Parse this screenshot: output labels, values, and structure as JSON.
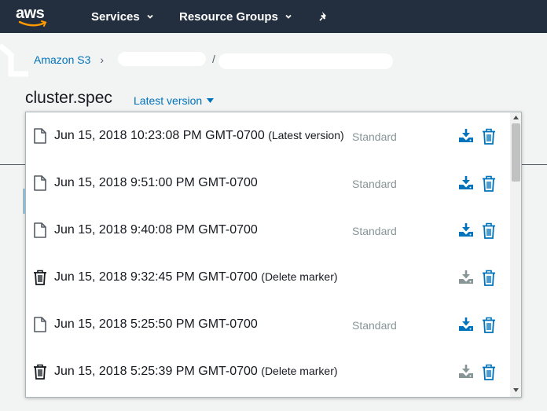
{
  "topnav": {
    "logo_text": "aws",
    "services_label": "Services",
    "resource_groups_label": "Resource Groups"
  },
  "breadcrumb": {
    "root": "Amazon S3",
    "separator": "/"
  },
  "page": {
    "title": "cluster.spec",
    "version_toggle_label": "Latest version"
  },
  "versions": [
    {
      "date": "Jun 15, 2018 10:23:08 PM GMT-0700",
      "note": "(Latest version)",
      "storage_class": "Standard",
      "type": "file",
      "download_enabled": true
    },
    {
      "date": "Jun 15, 2018 9:51:00 PM GMT-0700",
      "note": "",
      "storage_class": "Standard",
      "type": "file",
      "download_enabled": true
    },
    {
      "date": "Jun 15, 2018 9:40:08 PM GMT-0700",
      "note": "",
      "storage_class": "Standard",
      "type": "file",
      "download_enabled": true
    },
    {
      "date": "Jun 15, 2018 9:32:45 PM GMT-0700",
      "note": "(Delete marker)",
      "storage_class": "",
      "type": "delete-marker",
      "download_enabled": false
    },
    {
      "date": "Jun 15, 2018 5:25:50 PM GMT-0700",
      "note": "",
      "storage_class": "Standard",
      "type": "file",
      "download_enabled": true
    },
    {
      "date": "Jun 15, 2018 5:25:39 PM GMT-0700",
      "note": "(Delete marker)",
      "storage_class": "",
      "type": "delete-marker",
      "download_enabled": false
    }
  ],
  "colors": {
    "nav_bg": "#232f3e",
    "link": "#0073bb",
    "action_blue": "#0073bb",
    "action_disabled": "#879596",
    "storage_class": "#879596"
  }
}
